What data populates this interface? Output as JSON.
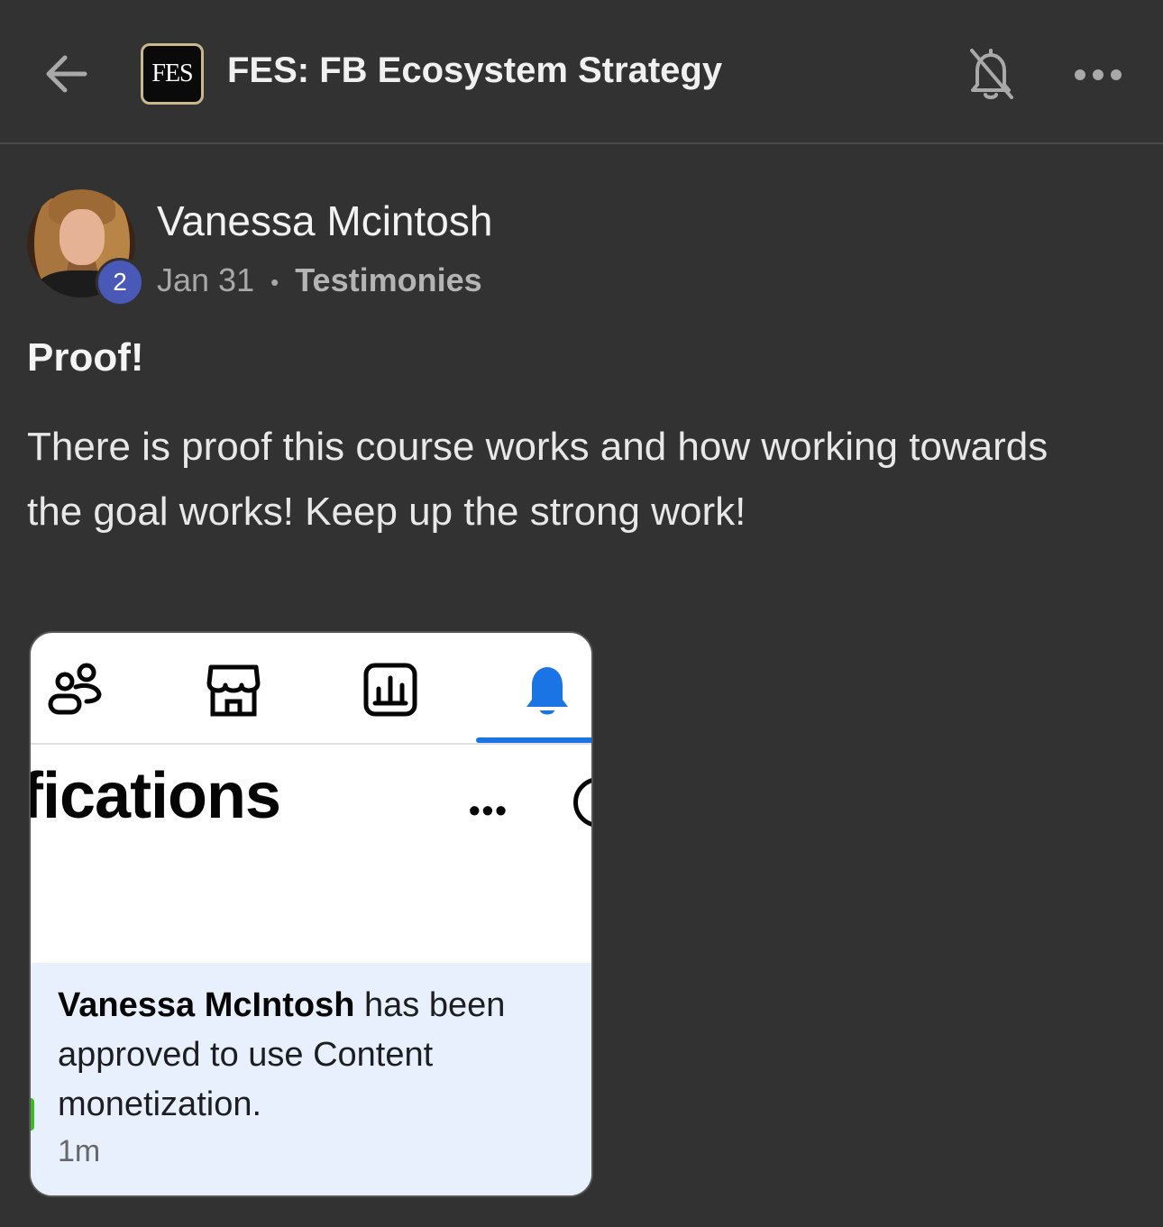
{
  "header": {
    "group_logo_text": "FES",
    "group_title": "FES: FB Ecosystem Strategy"
  },
  "post": {
    "author": "Vanessa Mcintosh",
    "level": "2",
    "date": "Jan 31",
    "separator": "•",
    "category": "Testimonies",
    "title": "Proof!",
    "body": "There is proof this course works and how working towards the goal works! Keep up the strong work!"
  },
  "attachment": {
    "heading": "fications",
    "more": "•••",
    "notification_name": "Vanessa McIntosh",
    "notification_text": " has been approved to use Content monetization.",
    "notification_time": "1m",
    "active_color": "#1b74e4"
  },
  "colors": {
    "background": "#323232",
    "badge": "#4a58b8"
  }
}
